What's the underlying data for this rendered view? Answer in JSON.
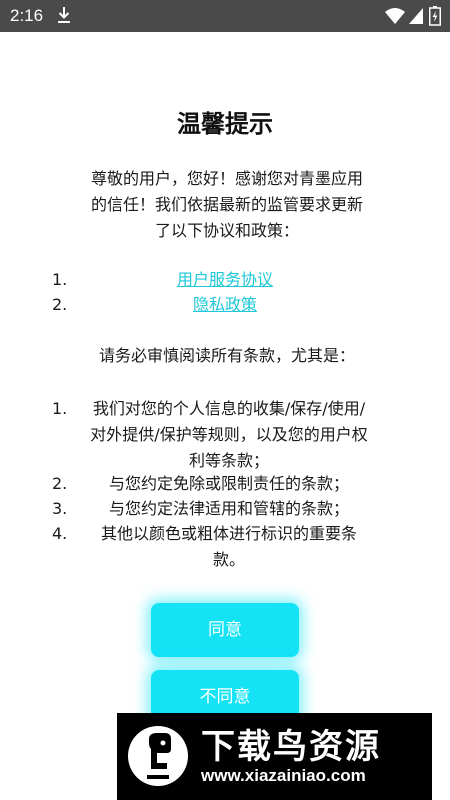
{
  "status_bar": {
    "time": "2:16",
    "icons": [
      "download-icon",
      "wifi-icon",
      "signal-icon",
      "battery-icon"
    ]
  },
  "dialog": {
    "title": "温馨提示",
    "intro_lines": [
      "尊敬的用户，您好！感谢您对青墨应用",
      "的信任！我们依据最新的监管要求更新",
      "了以下协议和政策："
    ],
    "links": [
      {
        "num": "1.",
        "label": "用户服务协议"
      },
      {
        "num": "2.",
        "label": "隐私政策"
      }
    ],
    "notice": "请务必审慎阅读所有条款，尤其是：",
    "clauses": [
      {
        "num": "1.",
        "lines": [
          "我们对您的个人信息的收集/保存/使用/",
          "对外提供/保护等规则，以及您的用户权",
          "利等条款；"
        ]
      },
      {
        "num": "2.",
        "lines": [
          "与您约定免除或限制责任的条款；"
        ]
      },
      {
        "num": "3.",
        "lines": [
          "与您约定法律适用和管辖的条款；"
        ]
      },
      {
        "num": "4.",
        "lines": [
          "其他以颜色或粗体进行标识的重要条",
          "款。"
        ]
      }
    ],
    "buttons": {
      "agree": "同意",
      "disagree": "不同意"
    }
  },
  "watermark": {
    "name": "下载鸟资源",
    "url": "www.xiazainiao.com"
  },
  "colors": {
    "status_bar": "#4a4a4a",
    "accent": "#13e3f5",
    "link": "#1ec8d8"
  }
}
